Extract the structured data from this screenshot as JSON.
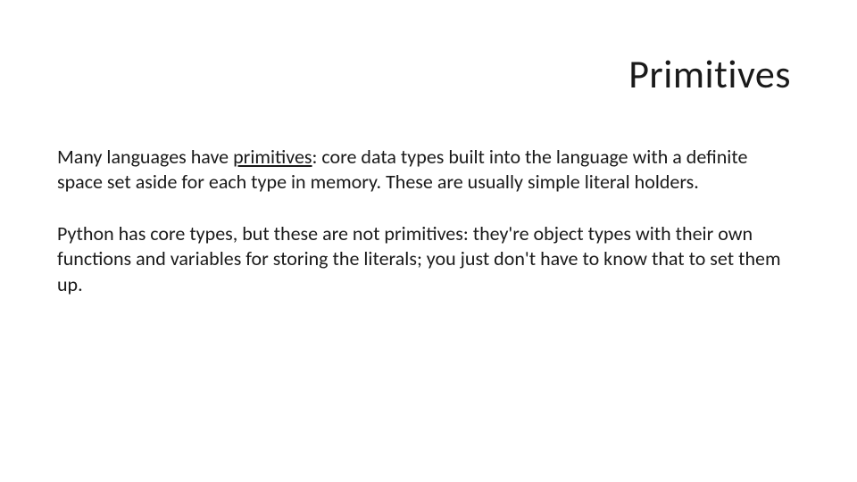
{
  "title": "Primitives",
  "paragraphs": {
    "p1_pre": "Many languages have ",
    "p1_underlined": "primitives",
    "p1_post": ": core data types built into the language with a definite space set aside for each type in memory. These are usually simple literal holders.",
    "p2": "Python has core types, but these are not primitives: they're object types with their own functions and variables for storing the literals; you just don't have to know that to set them up."
  }
}
